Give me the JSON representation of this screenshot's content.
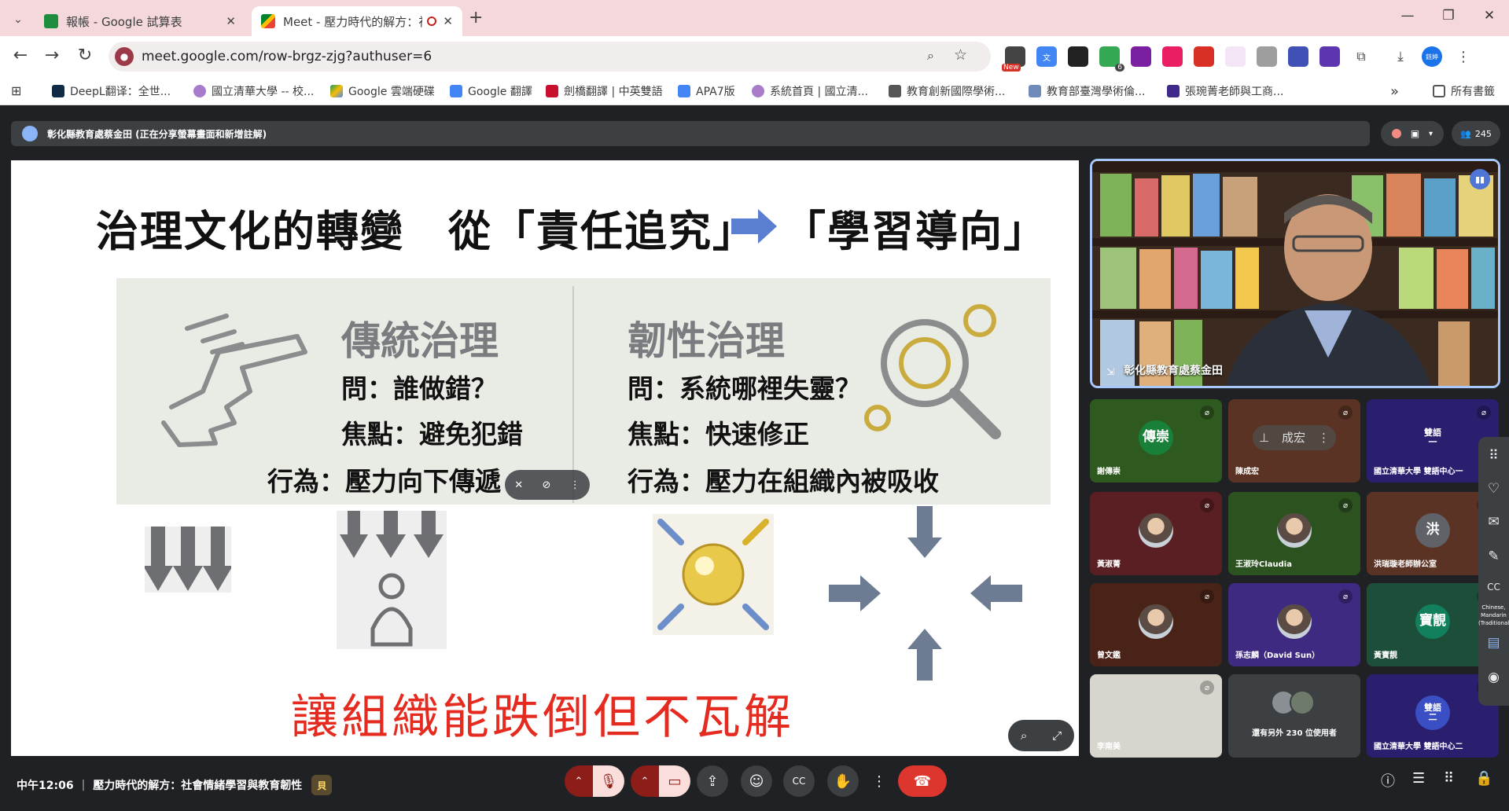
{
  "browser": {
    "tabs": [
      {
        "title": "報帳 - Google 試算表",
        "close": "✕"
      },
      {
        "title": "Meet - 壓力時代的解方：社",
        "close": "✕"
      }
    ],
    "new_tab": "+",
    "window_controls": {
      "minimize": "—",
      "restore": "❐",
      "close": "✕"
    },
    "url": "meet.google.com/row-brgz-zjg?authuser=6",
    "extensions_badge_new": "New",
    "extension_count": "6",
    "profile_initials": "鈺婷",
    "bookmarks": [
      "DeepL翻译：全世...",
      "國立清華大學 -- 校...",
      "Google 雲端硬碟",
      "Google 翻譯",
      "劍橋翻譯 | 中英雙語",
      "APA7版",
      "系統首頁 | 國立清...",
      "教育創新國際學術...",
      "教育部臺灣學術倫...",
      "張琬菁老師與工商..."
    ],
    "bookmarks_overflow": "»",
    "all_bookmarks": "所有書籤"
  },
  "meet": {
    "presenter_label": "彰化縣教育處蔡金田 (正在分享螢幕畫面和新增註解)",
    "participant_count": "245",
    "slide": {
      "title_part1": "治理文化的轉變　從「責任追究」",
      "title_part2": "「學習導向」",
      "left_heading": "傳統治理",
      "left_lines": [
        "問：誰做錯？",
        "焦點：避免犯錯",
        "行為：壓力向下傳遞"
      ],
      "right_heading": "韌性治理",
      "right_lines": [
        "問：系統哪裡失靈？",
        "焦點：快速修正",
        "行為：壓力在組織內被吸收"
      ],
      "slogan": "讓組織能跌倒但不瓦解"
    },
    "speaker": {
      "name": "彰化縣教育處蔡金田"
    },
    "tiles": [
      {
        "name": "謝傳崇",
        "avatar": "傳崇",
        "color": "#2f5a1f",
        "avatarColor": "#188038"
      },
      {
        "name": "陳成宏",
        "avatar": "成宏",
        "color": "#5b3324",
        "overlay": true
      },
      {
        "name": "國立清華大學 雙語中心一",
        "avatar": "雙語\n一",
        "color": "#2a1f6e",
        "avatarColor": "#2a1f6e"
      },
      {
        "name": "黃淑菁",
        "avatar": "",
        "color": "#5a1f22",
        "photo": true
      },
      {
        "name": "王淑玲Claudia",
        "avatar": "",
        "color": "#2c5220",
        "photo": true
      },
      {
        "name": "洪瑞璇老師辦公室",
        "avatar": "洪",
        "color": "#5b3324",
        "avatarColor": "#5f6368"
      },
      {
        "name": "曾文鑑",
        "avatar": "",
        "color": "#4a2318",
        "photo": true
      },
      {
        "name": "孫志麟（David Sun）",
        "avatar": "",
        "color": "#3e2a80",
        "photo": true
      },
      {
        "name": "黃寶靚",
        "avatar": "寶靚",
        "color": "#1d4e3a",
        "avatarColor": "#12805c"
      },
      {
        "name": "李南美",
        "avatar": "",
        "color": "#d8d4ce",
        "photo": true
      },
      {
        "name": "還有另外 230 位使用者",
        "avatar": "",
        "color": "#3c4043",
        "others": true
      },
      {
        "name": "國立清華大學 雙語中心二",
        "avatar": "雙語\n二",
        "color": "#2a1f6e",
        "avatarColor": "#3b4fc4"
      }
    ],
    "side_rail_cc_label": "Chinese, Mandarin (Traditional)",
    "time": "中午12:06",
    "meeting_title": "壓力時代的解方：社會情緒學習與教育韌性",
    "meeting_badge": "貝"
  },
  "colors": {
    "tab_strip": "#f5d8dc",
    "meet_bg": "#202124",
    "end_call": "#dc362e",
    "slogan_red": "#e52b1f",
    "active_tile_border": "#a8c7fa"
  }
}
